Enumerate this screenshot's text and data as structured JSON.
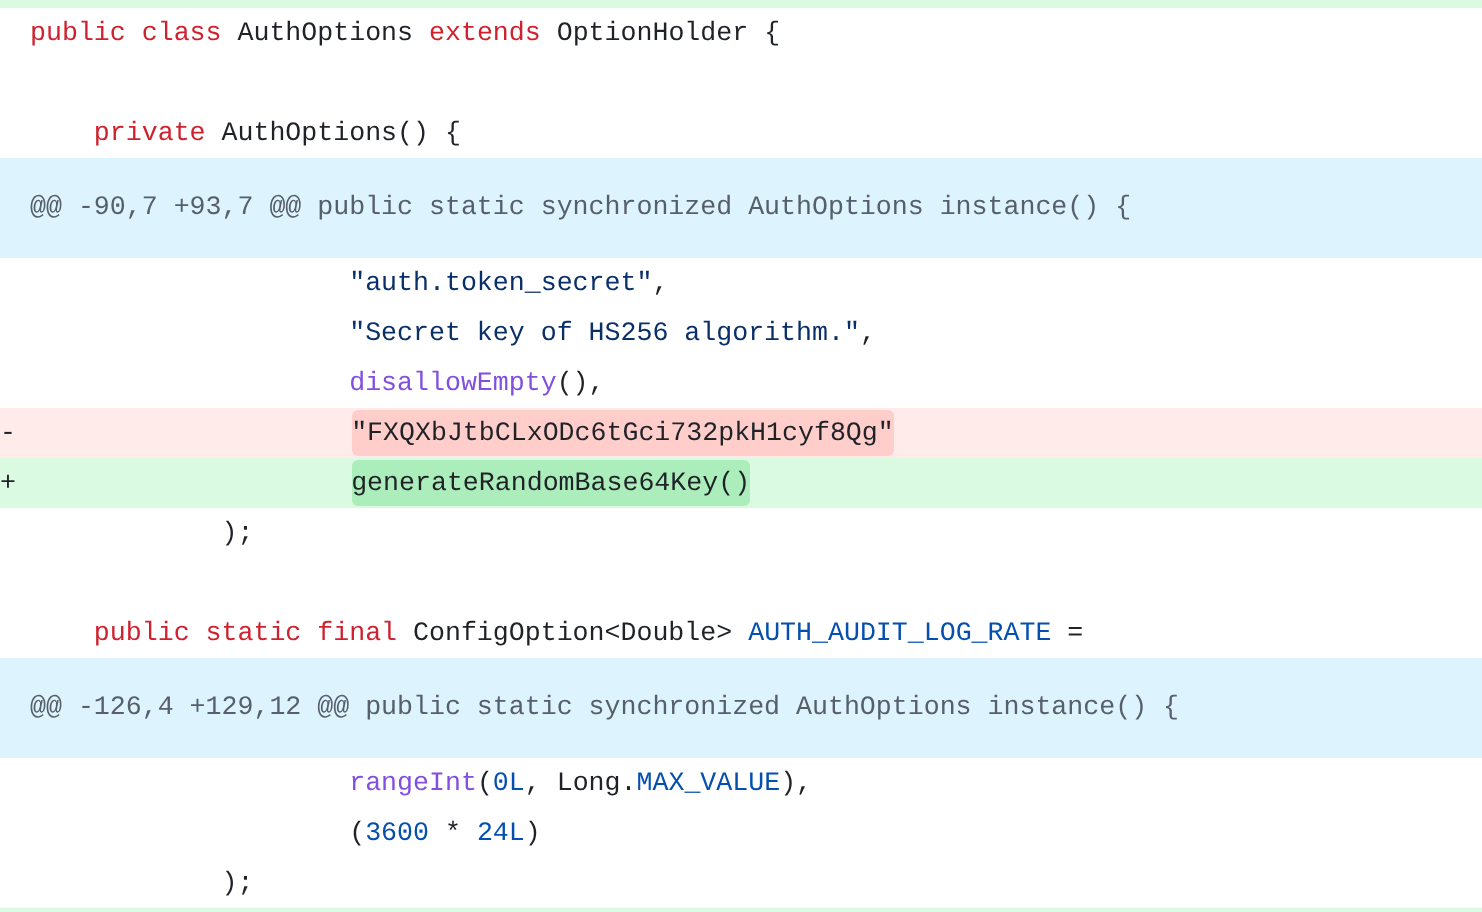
{
  "diff": {
    "lines": [
      {
        "kind": "edge-added"
      },
      {
        "kind": "context",
        "tokens": [
          {
            "kind": "keyword",
            "text": "public class "
          },
          {
            "kind": "plain",
            "text": "AuthOptions "
          },
          {
            "kind": "keyword",
            "text": "extends "
          },
          {
            "kind": "plain",
            "text": "OptionHolder {"
          }
        ]
      },
      {
        "kind": "blank"
      },
      {
        "kind": "context",
        "tokens": [
          {
            "kind": "keyword",
            "text": "    private "
          },
          {
            "kind": "plain",
            "text": "AuthOptions() {"
          }
        ]
      },
      {
        "kind": "hunk",
        "tokens": [
          {
            "kind": "hunk",
            "text": "@@ -90,7 +93,7 @@ public static synchronized AuthOptions instance() {"
          }
        ]
      },
      {
        "kind": "context",
        "tokens": [
          {
            "kind": "string",
            "text": "                    \"auth.token_secret\""
          },
          {
            "kind": "plain",
            "text": ","
          }
        ]
      },
      {
        "kind": "context",
        "tokens": [
          {
            "kind": "string",
            "text": "                    \"Secret key of HS256 algorithm.\""
          },
          {
            "kind": "plain",
            "text": ","
          }
        ]
      },
      {
        "kind": "context",
        "tokens": [
          {
            "kind": "method",
            "text": "                    disallowEmpty"
          },
          {
            "kind": "plain",
            "text": "(),"
          }
        ]
      },
      {
        "kind": "removed",
        "tokens": [
          {
            "kind": "marker",
            "text": "-                     "
          },
          {
            "kind": "plain",
            "text": "\"FXQXbJtbCLxODc6tGci732pkH1cyf8Qg\"",
            "highlighted": true
          }
        ]
      },
      {
        "kind": "added",
        "tokens": [
          {
            "kind": "marker",
            "text": "+                     "
          },
          {
            "kind": "plain",
            "text": "generateRandomBase64Key()",
            "highlighted": true
          }
        ]
      },
      {
        "kind": "context",
        "tokens": [
          {
            "kind": "plain",
            "text": "            );"
          }
        ]
      },
      {
        "kind": "blank"
      },
      {
        "kind": "context",
        "tokens": [
          {
            "kind": "keyword",
            "text": "    public static final "
          },
          {
            "kind": "plain",
            "text": "ConfigOption<Double> "
          },
          {
            "kind": "constant",
            "text": "AUTH_AUDIT_LOG_RATE"
          },
          {
            "kind": "plain",
            "text": " ="
          }
        ]
      },
      {
        "kind": "hunk",
        "tokens": [
          {
            "kind": "hunk",
            "text": "@@ -126,4 +129,12 @@ public static synchronized AuthOptions instance() {"
          }
        ]
      },
      {
        "kind": "context",
        "tokens": [
          {
            "kind": "method",
            "text": "                    rangeInt"
          },
          {
            "kind": "plain",
            "text": "("
          },
          {
            "kind": "constant",
            "text": "0L"
          },
          {
            "kind": "plain",
            "text": ", Long."
          },
          {
            "kind": "constant",
            "text": "MAX_VALUE"
          },
          {
            "kind": "plain",
            "text": "),"
          }
        ]
      },
      {
        "kind": "context",
        "tokens": [
          {
            "kind": "plain",
            "text": "                    ("
          },
          {
            "kind": "constant",
            "text": "3600"
          },
          {
            "kind": "plain",
            "text": " * "
          },
          {
            "kind": "constant",
            "text": "24L"
          },
          {
            "kind": "plain",
            "text": ")"
          }
        ]
      },
      {
        "kind": "context",
        "tokens": [
          {
            "kind": "plain",
            "text": "            );"
          }
        ]
      },
      {
        "kind": "edge-added"
      }
    ]
  }
}
